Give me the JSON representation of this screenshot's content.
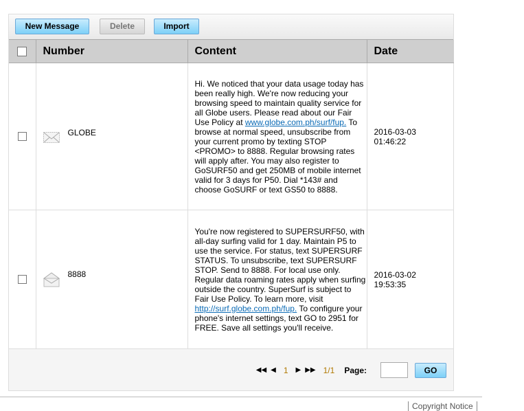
{
  "toolbar": {
    "new_message": "New Message",
    "delete": "Delete",
    "import": "Import"
  },
  "table": {
    "headers": [
      "Number",
      "Content",
      "Date"
    ],
    "rows": [
      {
        "number": "GLOBE",
        "icon": "envelope-closed-icon",
        "content_before": "Hi. We noticed that your data usage today has been really high. We're now reducing your browsing speed to maintain quality service for all Globe users. Please read about our Fair Use Policy at ",
        "link": "www.globe.com.ph/surf/fup.",
        "content_after": " To browse at normal speed, unsubscribe from your current promo by texting STOP <PROMO> to 8888. Regular browsing rates will apply after. You may also register to GoSURF50 and get 250MB of mobile internet valid for 3 days for P50. Dial *143# and choose GoSURF or text GS50 to 8888.",
        "date": "2016-03-03 01:46:22"
      },
      {
        "number": "8888",
        "icon": "envelope-open-icon",
        "content_before": "You're now registered to SUPERSURF50, with all-day surfing valid for 1 day. Maintain P5 to use the service. For status, text SUPERSURF STATUS. To unsubscribe, text SUPERSURF STOP. Send to 8888. For local use only.  Regular data roaming rates apply when surfing outside the country. SuperSurf is subject to Fair Use Policy. To learn more, visit ",
        "link": "http://surf.globe.com.ph/fup.",
        "content_after": " To configure your phone's internet settings, text GO to 2951 for FREE. Save all settings you'll receive.",
        "date": "2016-03-02 19:53:35"
      }
    ]
  },
  "pager": {
    "current": "1",
    "total": "1/1",
    "page_label": "Page:",
    "page_value": "",
    "go": "GO"
  },
  "footer": {
    "copyright": "Copyright Notice"
  }
}
